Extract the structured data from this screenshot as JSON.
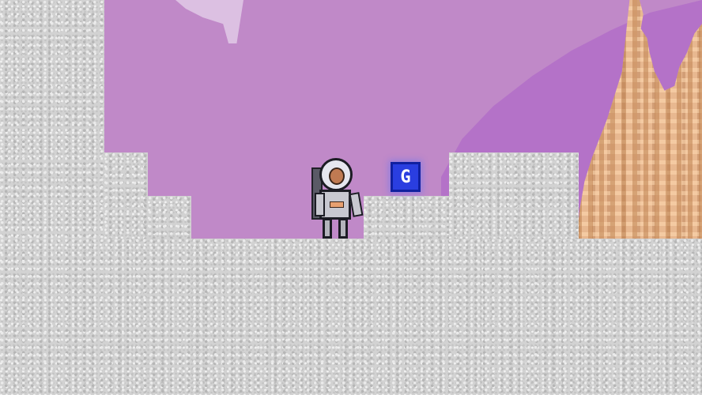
{
  "scene": {
    "name": "alien-canyon",
    "sky_color": "#c089c8",
    "sky_shadow_color": "#b472c8",
    "rock_color": "#d2d2d2",
    "spire_color": "#e8b890"
  },
  "player": {
    "sprite": "astronaut",
    "facing": "right",
    "state": "idle"
  },
  "pickup": {
    "label": "G",
    "color": "#2a3ee0"
  }
}
